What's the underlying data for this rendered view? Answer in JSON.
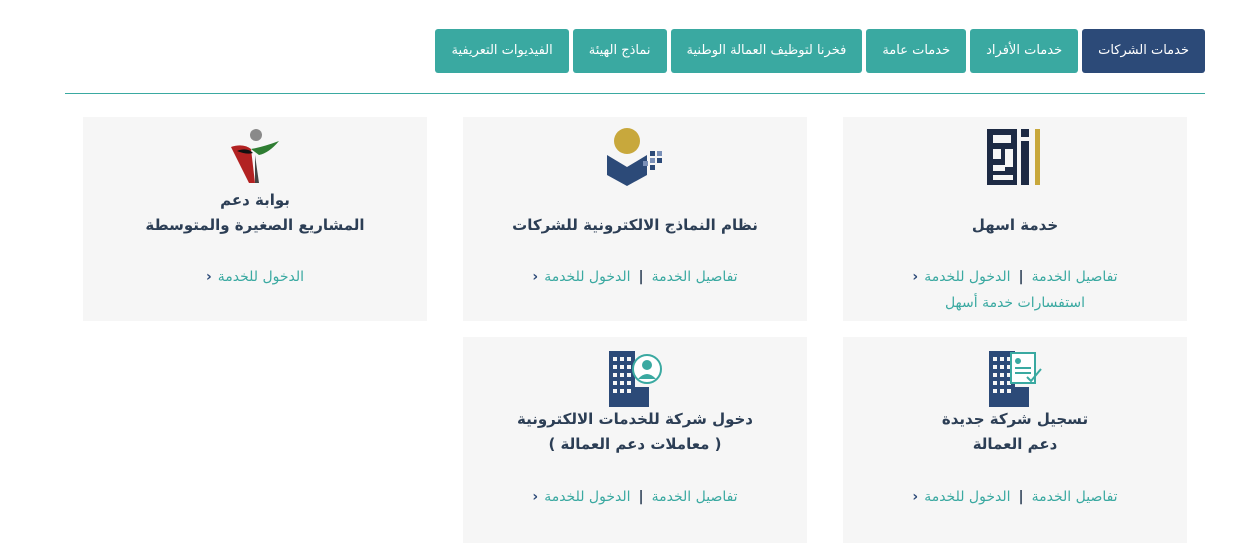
{
  "tabs": [
    {
      "label": "خدمات الشركات",
      "active": true
    },
    {
      "label": "خدمات الأفراد"
    },
    {
      "label": "خدمات عامة"
    },
    {
      "label": "فخرنا لتوظيف العمالة الوطنية"
    },
    {
      "label": "نماذج الهيئة"
    },
    {
      "label": "الفيديوات التعريفية"
    }
  ],
  "cards": {
    "ashal": {
      "title": "خدمة اسهل",
      "details": "تفاصيل الخدمة",
      "enter": "الدخول للخدمة",
      "extra": "استفسارات خدمة أسهل"
    },
    "forms": {
      "title": "نظام النماذج الالكترونية للشركات",
      "details": "تفاصيل الخدمة",
      "enter": "الدخول للخدمة"
    },
    "sme": {
      "title_line1": "بوابة دعم",
      "title_line2": "المشاريع الصغيرة والمتوسطة",
      "enter": "الدخول للخدمة"
    },
    "register": {
      "title_line1": "تسجيل شركة جديدة",
      "title_line2": "دعم العمالة",
      "details": "تفاصيل الخدمة",
      "enter": "الدخول للخدمة"
    },
    "login": {
      "title_line1": "دخول شركة للخدمات الالكترونية",
      "title_line2": "( معاملات دعم العمالة )",
      "details": "تفاصيل الخدمة",
      "enter": "الدخول للخدمة"
    }
  },
  "icons": {
    "chevron": "‹",
    "separator": "|"
  },
  "colors": {
    "teal": "#3aa9a1",
    "navy": "#2c4a78",
    "text": "#2c3e55",
    "card_bg": "#f6f6f6",
    "gold": "#c8a83c"
  }
}
